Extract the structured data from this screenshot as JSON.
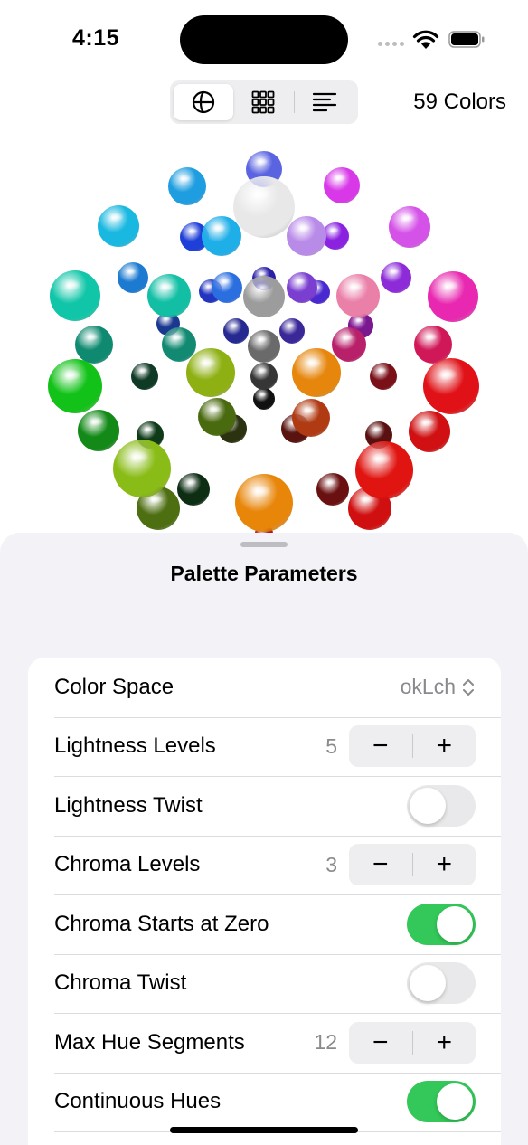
{
  "status_bar": {
    "time": "4:15"
  },
  "toolbar": {
    "view_modes": [
      {
        "icon": "globe-icon",
        "selected": true
      },
      {
        "icon": "grid-icon",
        "selected": false
      },
      {
        "icon": "list-icon",
        "selected": false
      }
    ],
    "color_count": "59 Colors"
  },
  "palette_spheres": [
    {
      "color": "#5a63e0"
    },
    {
      "color": "#1e9ee0"
    },
    {
      "color": "#e8e8e8"
    },
    {
      "color": "#d838e8"
    },
    {
      "color": "#19b8e0"
    },
    {
      "color": "#1e3fd8"
    },
    {
      "color": "#1eaee8"
    },
    {
      "color": "#b98be8"
    },
    {
      "color": "#8a22e0"
    },
    {
      "color": "#d552e8"
    },
    {
      "color": "#1c7ad0"
    },
    {
      "color": "#8e2bd8"
    },
    {
      "color": "#11c6a8"
    },
    {
      "color": "#12bfa5"
    },
    {
      "color": "#2335c0"
    },
    {
      "color": "#2a6ee0"
    },
    {
      "color": "#9c9c9c"
    },
    {
      "color": "#2b20a8"
    },
    {
      "color": "#7a3ed0"
    },
    {
      "color": "#4a2ad0"
    },
    {
      "color": "#ea7fa8"
    },
    {
      "color": "#b020c8"
    },
    {
      "color": "#e828b0"
    },
    {
      "color": "#1a3890"
    },
    {
      "color": "#262a90"
    },
    {
      "color": "#3a2898"
    },
    {
      "color": "#7a1890"
    },
    {
      "color": "#0f8a70"
    },
    {
      "color": "#128a72"
    },
    {
      "color": "#6a6a6a"
    },
    {
      "color": "#b8206a"
    },
    {
      "color": "#d01858"
    },
    {
      "color": "#12c218"
    },
    {
      "color": "#0e3a26"
    },
    {
      "color": "#8eb012"
    },
    {
      "color": "#363636"
    },
    {
      "color": "#e6860c"
    },
    {
      "color": "#7a1018"
    },
    {
      "color": "#e01218"
    },
    {
      "color": "#111111"
    },
    {
      "color": "#4a6a10"
    },
    {
      "color": "#2a3210"
    },
    {
      "color": "#5a1410"
    },
    {
      "color": "#b03a12"
    },
    {
      "color": "#138a18"
    },
    {
      "color": "#0e3a18"
    },
    {
      "color": "#5a1010"
    },
    {
      "color": "#d01012"
    },
    {
      "color": "#8abc18"
    },
    {
      "color": "#e01410"
    },
    {
      "color": "#0e2e14"
    },
    {
      "color": "#6a1010"
    },
    {
      "color": "#4e6e12"
    },
    {
      "color": "#e8860a"
    },
    {
      "color": "#d01010"
    },
    {
      "color": "#b81a1a"
    }
  ],
  "sheet": {
    "title": "Palette Parameters",
    "rows": [
      {
        "label": "Color Space",
        "control": "picker",
        "value": "okLch"
      },
      {
        "label": "Lightness Levels",
        "control": "stepper",
        "value": "5"
      },
      {
        "label": "Lightness Twist",
        "control": "toggle",
        "on": false
      },
      {
        "label": "Chroma Levels",
        "control": "stepper",
        "value": "3"
      },
      {
        "label": "Chroma Starts at Zero",
        "control": "toggle",
        "on": true
      },
      {
        "label": "Chroma Twist",
        "control": "toggle",
        "on": false
      },
      {
        "label": "Max Hue Segments",
        "control": "stepper",
        "value": "12"
      },
      {
        "label": "Continuous Hues",
        "control": "toggle",
        "on": true
      }
    ],
    "stepper_minus": "−",
    "stepper_plus": "+"
  },
  "colors": {
    "toggle_on": "#34c759",
    "toggle_off": "#e9e9eb",
    "sheet_bg": "#f2f2f7"
  }
}
